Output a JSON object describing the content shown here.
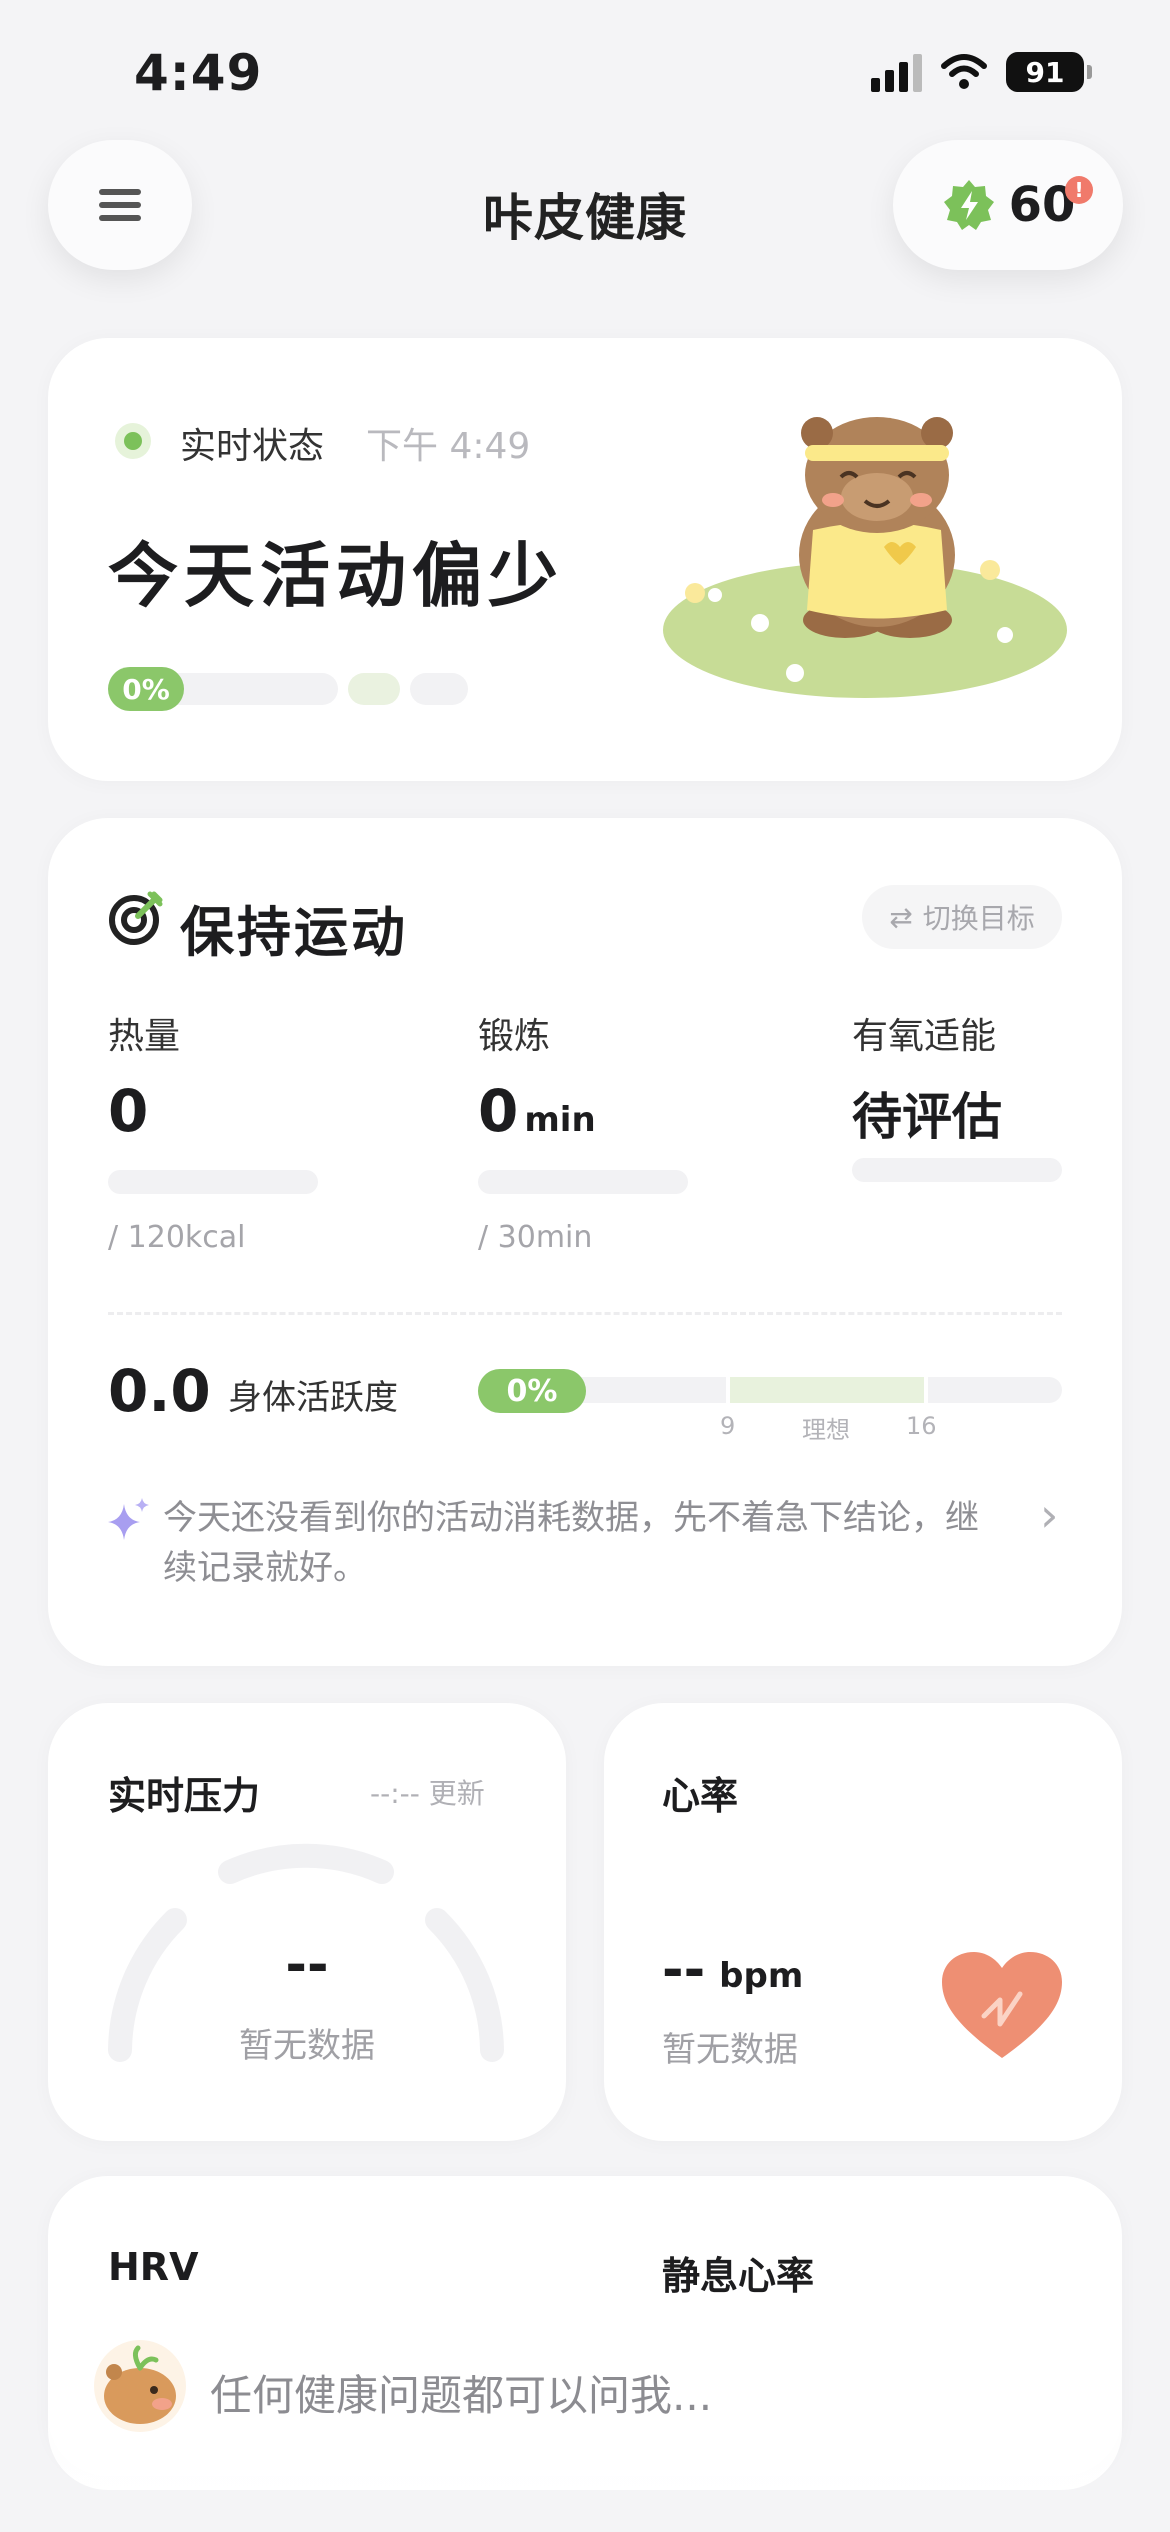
{
  "status_bar": {
    "time": "4:49",
    "battery": "91"
  },
  "header": {
    "title": "咔皮健康",
    "points": "60",
    "badge": "!"
  },
  "status_card": {
    "label": "实时状态",
    "time": "下午 4:49",
    "headline": "今天活动偏少",
    "progress_label": "0%",
    "progress": 0
  },
  "exercise_card": {
    "title": "保持运动",
    "switch_button": "切换目标",
    "switch_icon": "⇄",
    "metrics": [
      {
        "label": "热量",
        "value": "0",
        "unit": "",
        "target": "/ 120kcal"
      },
      {
        "label": "锻炼",
        "value": "0",
        "unit": "min",
        "target": "/ 30min"
      },
      {
        "label": "有氧适能",
        "value": "待评估",
        "unit": "",
        "target": ""
      }
    ],
    "activity": {
      "value": "0.0",
      "label": "身体活跃度",
      "progress_label": "0%",
      "progress": 0,
      "ticks": [
        "9",
        "理想",
        "16"
      ]
    },
    "hint": "今天还没看到你的活动消耗数据，先不着急下结论，继续记录就好。",
    "hint_arrow": "›"
  },
  "stress_card": {
    "title": "实时压力",
    "updated": "--:-- 更新",
    "value": "--",
    "nodata": "暂无数据"
  },
  "heart_card": {
    "title": "心率",
    "value": "--",
    "unit": "bpm",
    "nodata": "暂无数据"
  },
  "bottom_card": {
    "hrv": "HRV",
    "resting": "静息心率"
  },
  "chat": {
    "placeholder": "任何健康问题都可以问我..."
  },
  "colors": {
    "accent_green": "#8bc76a",
    "heart": "#ee8f73",
    "background": "#f4f4f6"
  },
  "icons": [
    "menu-icon",
    "bolt-icon",
    "target-icon",
    "sparkle-icon",
    "chevron-right-icon",
    "heart-icon",
    "capybara-mascot"
  ]
}
